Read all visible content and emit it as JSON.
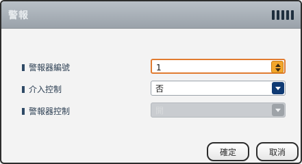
{
  "dialog": {
    "title": "警報",
    "fields": [
      {
        "label": "警報器編號",
        "value": "1"
      },
      {
        "label": "介入控制",
        "value": "否"
      },
      {
        "label": "警報器控制",
        "value": "開"
      }
    ],
    "buttons": {
      "ok": "確定",
      "cancel": "取消"
    }
  },
  "colors": {
    "titlebar": "#9aa2aa",
    "focus_border": "#e17b2f",
    "stepper_accent": "#f2a62b",
    "select_accent": "#0f3a73",
    "label_text": "#2e4054"
  }
}
